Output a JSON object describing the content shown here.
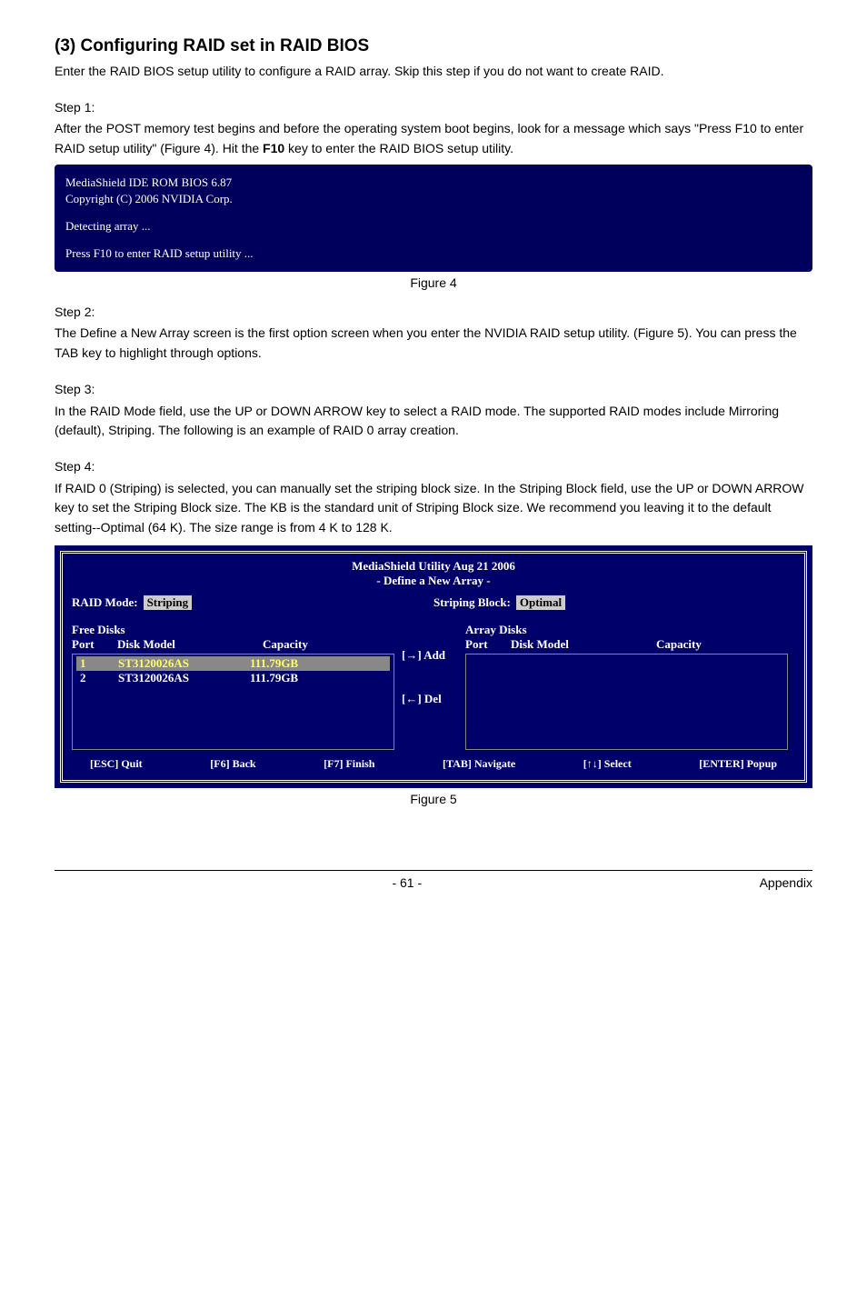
{
  "heading": "(3) Configuring RAID set in RAID BIOS",
  "intro": "Enter the RAID BIOS setup utility to configure a RAID array. Skip this step if you do not want to create RAID.",
  "step1_label": "Step 1:",
  "step1_text_a": "After the POST memory test begins and before the operating system boot begins, look for a message which says \"Press F10 to enter RAID setup utility\" (Figure 4). Hit the ",
  "step1_bold": "F10",
  "step1_text_b": " key to enter the RAID BIOS setup utility.",
  "bios_block": {
    "line1": "MediaShield IDE ROM BIOS 6.87",
    "line2": "Copyright (C) 2006 NVIDIA Corp.",
    "line3": "Detecting array ...",
    "line4": "Press F10 to enter RAID setup utility ..."
  },
  "fig4_caption": "Figure 4",
  "step2_label": "Step 2:",
  "step2_text": "The Define a New Array screen is the first option screen when you enter the NVIDIA RAID setup utility. (Figure 5). You can press the TAB key to highlight through options.",
  "step3_label": "Step 3:",
  "step3_text": "In the RAID Mode field, use the UP or DOWN ARROW key to select a RAID mode. The supported RAID modes include Mirroring (default), Striping. The following is an example of RAID 0 array creation.",
  "step4_label": "Step 4:",
  "step4_text": "If RAID 0 (Striping) is selected, you can manually set the striping block size. In the Striping Block field, use the UP or DOWN ARROW key to set the Striping Block size. The KB is the standard unit of Striping Block size.  We recommend you leaving it to the default setting--Optimal (64 K). The size range is from 4 K to 128 K.",
  "utility": {
    "title_line1": "MediaShield Utility  Aug 21 2006",
    "title_line2": "- Define a New Array -",
    "raid_mode_label": "RAID Mode:",
    "raid_mode_value": "Striping",
    "striping_block_label": "Striping Block:",
    "striping_block_value": "Optimal",
    "free_disks_title": "Free Disks",
    "array_disks_title": "Array Disks",
    "col_port": "Port",
    "col_model": "Disk Model",
    "col_capacity": "Capacity",
    "free_disks": [
      {
        "port": "1",
        "model": "ST3120026AS",
        "capacity": "111.79GB",
        "selected": true
      },
      {
        "port": "2",
        "model": "ST3120026AS",
        "capacity": "111.79GB",
        "selected": false
      }
    ],
    "add_label": "[→] Add",
    "del_label": "[←] Del",
    "footer": {
      "esc": "[ESC] Quit",
      "f6": "[F6] Back",
      "f7": "[F7] Finish",
      "tab": "[TAB] Navigate",
      "select": "[↑↓] Select",
      "enter": "[ENTER] Popup"
    }
  },
  "fig5_caption": "Figure 5",
  "page_number": "- 61 -",
  "footer_right": "Appendix"
}
